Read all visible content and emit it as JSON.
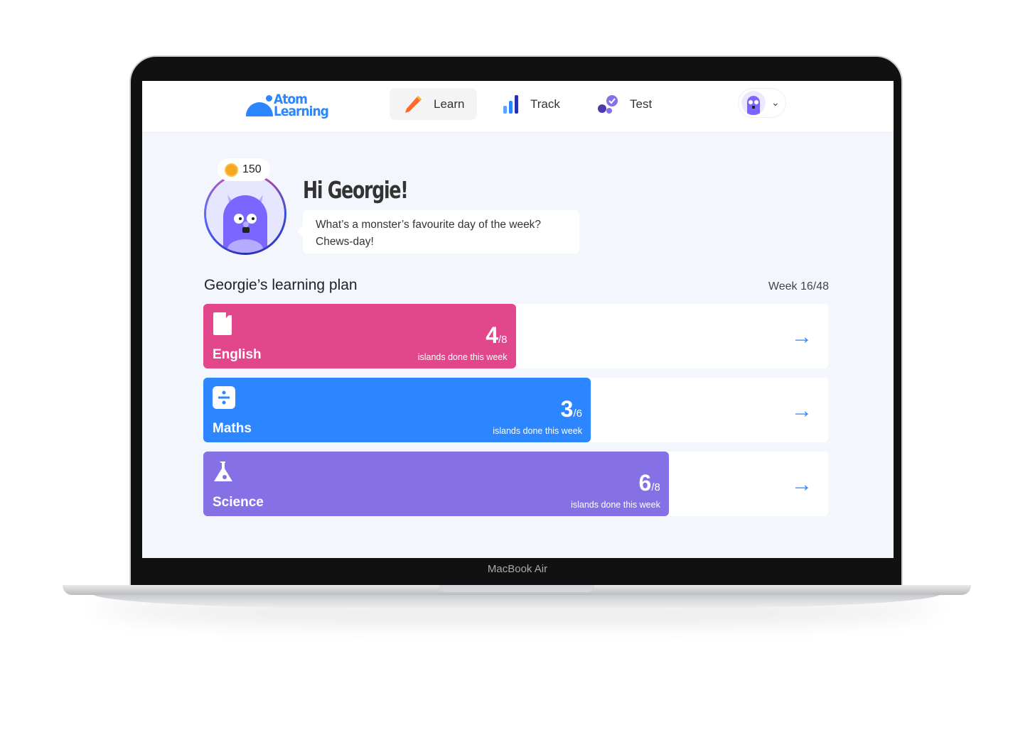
{
  "device": {
    "label": "MacBook Air"
  },
  "nav": {
    "logo": "Atom Learning",
    "items": [
      {
        "label": "Learn",
        "icon": "pencil-icon",
        "active": true
      },
      {
        "label": "Track",
        "icon": "bar-chart-icon"
      },
      {
        "label": "Test",
        "icon": "check-cross-icon"
      }
    ]
  },
  "greeting": {
    "coins": "150",
    "title": "Hi Georgie!",
    "joke_line1": "What’s a monster’s favourite day of the week?",
    "joke_line2": "Chews-day!"
  },
  "plan": {
    "title": "Georgie’s learning plan",
    "week": "Week 16/48",
    "caption": "islands done this week",
    "subjects": [
      {
        "name": "English",
        "done": "4",
        "total": "/8",
        "color": "#e2468b",
        "fill_percent": 50,
        "icon": "book-icon"
      },
      {
        "name": "Maths",
        "done": "3",
        "total": "/6",
        "color": "#2b86ff",
        "fill_percent": 62,
        "icon": "divide-icon"
      },
      {
        "name": "Science",
        "done": "6",
        "total": "/8",
        "color": "#8570e6",
        "fill_percent": 74.5,
        "icon": "flask-icon"
      }
    ]
  },
  "colors": {
    "accent": "#2b86ff"
  }
}
